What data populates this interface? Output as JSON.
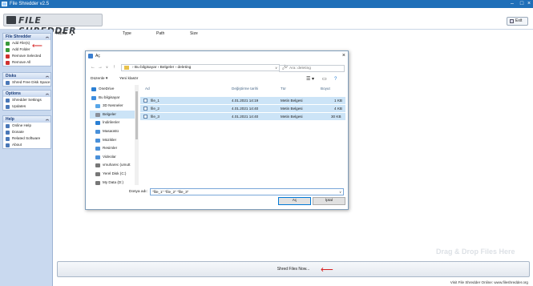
{
  "window": {
    "title": "File Shredder v2.5"
  },
  "header": {
    "logo_text": "FILE SHREDDER",
    "exit_label": "Exit"
  },
  "file_columns": [
    "Name",
    "Type",
    "Path",
    "Size"
  ],
  "sidebar": {
    "panels": [
      {
        "title": "File Shredder",
        "items": [
          {
            "label": "Add File(s)",
            "icon": "add-file-icon",
            "color": "#3a9a3a"
          },
          {
            "label": "Add Folder",
            "icon": "add-folder-icon",
            "color": "#3a9a3a"
          },
          {
            "label": "Remove Selected",
            "icon": "remove-icon",
            "color": "#d03030"
          },
          {
            "label": "Remove All",
            "icon": "remove-all-icon",
            "color": "#d03030"
          }
        ]
      },
      {
        "title": "Disks",
        "items": [
          {
            "label": "Shred Free Disk Space",
            "icon": "disk-icon",
            "color": "#4a78b8"
          }
        ]
      },
      {
        "title": "Options",
        "items": [
          {
            "label": "Shredder Settings",
            "icon": "settings-icon",
            "color": "#4a78b8"
          },
          {
            "label": "Updates",
            "icon": "updates-icon",
            "color": "#4a78b8"
          }
        ]
      },
      {
        "title": "Help",
        "items": [
          {
            "label": "Online Help",
            "icon": "help-icon",
            "color": "#4a78b8"
          },
          {
            "label": "Donate",
            "icon": "donate-icon",
            "color": "#4a78b8"
          },
          {
            "label": "Related Software",
            "icon": "software-icon",
            "color": "#4a78b8"
          },
          {
            "label": "About",
            "icon": "about-icon",
            "color": "#4a78b8"
          }
        ]
      }
    ]
  },
  "main": {
    "drag_drop_text": "Drag & Drop Files Here",
    "shred_button": "Shred Files Now..."
  },
  "footer": {
    "text": "Visit File Shredder Online: www.fileshredder.org"
  },
  "dialog": {
    "title": "Aç",
    "breadcrumb": "›  Bu bilgisayar  ›  Belgeler  ›  deleting",
    "search_placeholder": "Ara: deleting",
    "toolbar": {
      "organize": "Düzenle ▾",
      "new_folder": "Yeni klasör"
    },
    "nav_items": [
      {
        "label": "OneDrive",
        "icon": "onedrive-icon",
        "color": "#2a7fd4"
      },
      {
        "label": "Bu bilgisayar",
        "icon": "computer-icon",
        "color": "#3c8de0"
      },
      {
        "label": "3D Nesneler",
        "icon": "3d-objects-icon",
        "color": "#58a6e8"
      },
      {
        "label": "Belgeler",
        "icon": "documents-icon",
        "color": "#8a8f99",
        "selected": true
      },
      {
        "label": "İndirilenler",
        "icon": "downloads-icon",
        "color": "#2a7fd4"
      },
      {
        "label": "Masaüstü",
        "icon": "desktop-icon",
        "color": "#4a90d9"
      },
      {
        "label": "Müzikler",
        "icon": "music-icon",
        "color": "#4a90d9"
      },
      {
        "label": "Resimler",
        "icon": "pictures-icon",
        "color": "#4a90d9"
      },
      {
        "label": "Videolar",
        "icon": "videos-icon",
        "color": "#4a90d9"
      },
      {
        "label": "vmuharec (umutt",
        "icon": "network-drive-icon",
        "color": "#777"
      },
      {
        "label": "Yerel Disk (C:)",
        "icon": "local-disk-icon",
        "color": "#777"
      },
      {
        "label": "My Data (D:)",
        "icon": "data-disk-icon",
        "color": "#777"
      }
    ],
    "columns": [
      "Ad",
      "Değiştirme tarihi",
      "Tür",
      "Boyut"
    ],
    "files": [
      {
        "name": "file_1",
        "date": "4.01.2021 14:19",
        "type": "Metin Belgesi",
        "size": "1 KB"
      },
      {
        "name": "file_2",
        "date": "4.01.2021 14:40",
        "type": "Metin Belgesi",
        "size": "4 KB"
      },
      {
        "name": "file_3",
        "date": "4.01.2021 14:40",
        "type": "Metin Belgesi",
        "size": "30 KB"
      }
    ],
    "filename_label": "Dosya adı:",
    "filename_value": "\"file_1\" \"file_2\" \"file_3\"",
    "open_button": "Aç",
    "cancel_button": "İptal"
  }
}
